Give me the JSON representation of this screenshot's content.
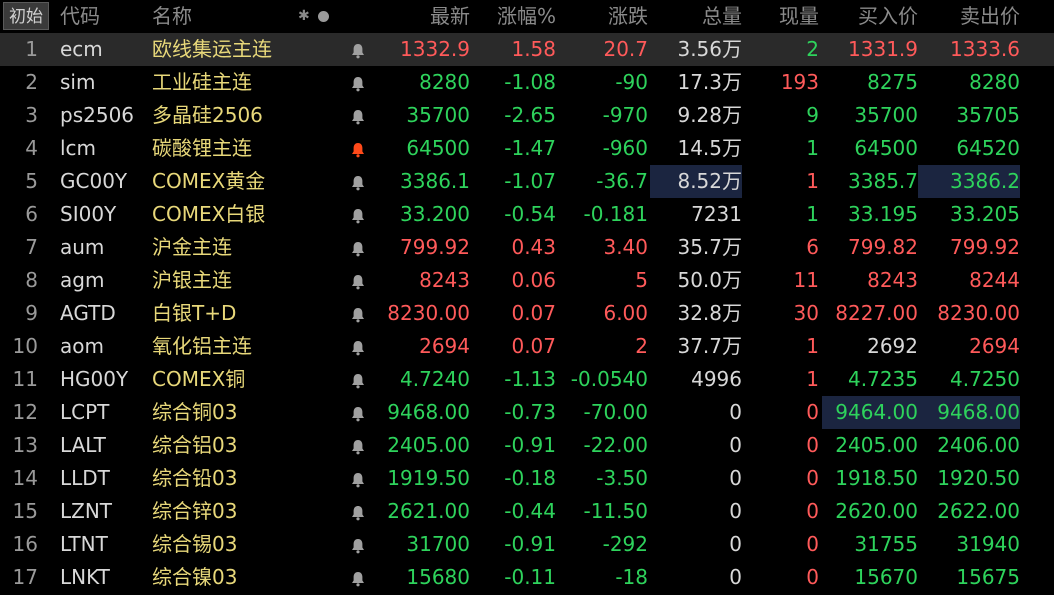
{
  "header": {
    "init_label": "初始",
    "col_code": "代码",
    "col_name": "名称",
    "col_last": "最新",
    "col_pct": "涨幅%",
    "col_chg": "涨跌",
    "col_vol": "总量",
    "col_cur": "现量",
    "col_bid": "买入价",
    "col_ask": "卖出价",
    "icons": [
      "snowflake-icon",
      "dot-icon"
    ]
  },
  "colors": {
    "up": "#ff5a5a",
    "down": "#2ed35c",
    "name": "#e8d87a",
    "bell": "#a0a0a0",
    "bell_active": "#ff4a1a",
    "highlight": "#1b2540",
    "selected_row": "#2a2a2a"
  },
  "rows": [
    {
      "idx": "1",
      "code": "ecm",
      "name": "欧线集运主连",
      "bell": "bell-icon",
      "last": "1332.9",
      "pct": "1.58",
      "chg": "20.7",
      "vol": "3.56万",
      "cur": "2",
      "bid": "1331.9",
      "ask": "1333.6",
      "dir": "up",
      "bid_dir": "up",
      "ask_dir": "up",
      "cur_dir": "down"
    },
    {
      "idx": "2",
      "code": "sim",
      "name": "工业硅主连",
      "bell": "bell-icon",
      "last": "8280",
      "pct": "-1.08",
      "chg": "-90",
      "vol": "17.3万",
      "cur": "193",
      "bid": "8275",
      "ask": "8280",
      "dir": "down",
      "bid_dir": "down",
      "ask_dir": "down",
      "cur_dir": "up"
    },
    {
      "idx": "3",
      "code": "ps2506",
      "name": "多晶硅2506",
      "bell": "bell-icon",
      "last": "35700",
      "pct": "-2.65",
      "chg": "-970",
      "vol": "9.28万",
      "cur": "9",
      "bid": "35700",
      "ask": "35705",
      "dir": "down",
      "bid_dir": "down",
      "ask_dir": "down",
      "cur_dir": "down"
    },
    {
      "idx": "4",
      "code": "lcm",
      "name": "碳酸锂主连",
      "bell": "bell-active-icon",
      "last": "64500",
      "pct": "-1.47",
      "chg": "-960",
      "vol": "14.5万",
      "cur": "1",
      "bid": "64500",
      "ask": "64520",
      "dir": "down",
      "bid_dir": "down",
      "ask_dir": "down",
      "cur_dir": "down"
    },
    {
      "idx": "5",
      "code": "GC00Y",
      "name": "COMEX黄金",
      "bell": "bell-icon",
      "last": "3386.1",
      "pct": "-1.07",
      "chg": "-36.7",
      "vol": "8.52万",
      "cur": "1",
      "bid": "3385.7",
      "ask": "3386.2",
      "dir": "down",
      "bid_dir": "down",
      "ask_dir": "down",
      "cur_dir": "up",
      "vol_hl": true,
      "ask_hl": true
    },
    {
      "idx": "6",
      "code": "SI00Y",
      "name": "COMEX白银",
      "bell": "bell-icon",
      "last": "33.200",
      "pct": "-0.54",
      "chg": "-0.181",
      "vol": "7231",
      "cur": "1",
      "bid": "33.195",
      "ask": "33.205",
      "dir": "down",
      "bid_dir": "down",
      "ask_dir": "down",
      "cur_dir": "down"
    },
    {
      "idx": "7",
      "code": "aum",
      "name": "沪金主连",
      "bell": "bell-icon",
      "last": "799.92",
      "pct": "0.43",
      "chg": "3.40",
      "vol": "35.7万",
      "cur": "6",
      "bid": "799.82",
      "ask": "799.92",
      "dir": "up",
      "bid_dir": "up",
      "ask_dir": "up",
      "cur_dir": "up"
    },
    {
      "idx": "8",
      "code": "agm",
      "name": "沪银主连",
      "bell": "bell-icon",
      "last": "8243",
      "pct": "0.06",
      "chg": "5",
      "vol": "50.0万",
      "cur": "11",
      "bid": "8243",
      "ask": "8244",
      "dir": "up",
      "bid_dir": "up",
      "ask_dir": "up",
      "cur_dir": "up"
    },
    {
      "idx": "9",
      "code": "AGTD",
      "name": "白银T+D",
      "bell": "bell-icon",
      "last": "8230.00",
      "pct": "0.07",
      "chg": "6.00",
      "vol": "32.8万",
      "cur": "30",
      "bid": "8227.00",
      "ask": "8230.00",
      "dir": "up",
      "bid_dir": "up",
      "ask_dir": "up",
      "cur_dir": "up"
    },
    {
      "idx": "10",
      "code": "aom",
      "name": "氧化铝主连",
      "bell": "bell-icon",
      "last": "2694",
      "pct": "0.07",
      "chg": "2",
      "vol": "37.7万",
      "cur": "1",
      "bid": "2692",
      "ask": "2694",
      "dir": "up",
      "bid_dir": "flat",
      "ask_dir": "up",
      "cur_dir": "up"
    },
    {
      "idx": "11",
      "code": "HG00Y",
      "name": "COMEX铜",
      "bell": "bell-icon",
      "last": "4.7240",
      "pct": "-1.13",
      "chg": "-0.0540",
      "vol": "4996",
      "cur": "1",
      "bid": "4.7235",
      "ask": "4.7250",
      "dir": "down",
      "bid_dir": "down",
      "ask_dir": "down",
      "cur_dir": "up"
    },
    {
      "idx": "12",
      "code": "LCPT",
      "name": "综合铜03",
      "bell": "bell-icon",
      "last": "9468.00",
      "pct": "-0.73",
      "chg": "-70.00",
      "vol": "0",
      "cur": "0",
      "bid": "9464.00",
      "ask": "9468.00",
      "dir": "down",
      "bid_dir": "down",
      "ask_dir": "down",
      "cur_dir": "up",
      "bid_hl": true,
      "ask_hl": true
    },
    {
      "idx": "13",
      "code": "LALT",
      "name": "综合铝03",
      "bell": "bell-icon",
      "last": "2405.00",
      "pct": "-0.91",
      "chg": "-22.00",
      "vol": "0",
      "cur": "0",
      "bid": "2405.00",
      "ask": "2406.00",
      "dir": "down",
      "bid_dir": "down",
      "ask_dir": "down",
      "cur_dir": "up"
    },
    {
      "idx": "14",
      "code": "LLDT",
      "name": "综合铅03",
      "bell": "bell-icon",
      "last": "1919.50",
      "pct": "-0.18",
      "chg": "-3.50",
      "vol": "0",
      "cur": "0",
      "bid": "1918.50",
      "ask": "1920.50",
      "dir": "down",
      "bid_dir": "down",
      "ask_dir": "down",
      "cur_dir": "up"
    },
    {
      "idx": "15",
      "code": "LZNT",
      "name": "综合锌03",
      "bell": "bell-icon",
      "last": "2621.00",
      "pct": "-0.44",
      "chg": "-11.50",
      "vol": "0",
      "cur": "0",
      "bid": "2620.00",
      "ask": "2622.00",
      "dir": "down",
      "bid_dir": "down",
      "ask_dir": "down",
      "cur_dir": "up"
    },
    {
      "idx": "16",
      "code": "LTNT",
      "name": "综合锡03",
      "bell": "bell-icon",
      "last": "31700",
      "pct": "-0.91",
      "chg": "-292",
      "vol": "0",
      "cur": "0",
      "bid": "31755",
      "ask": "31940",
      "dir": "down",
      "bid_dir": "down",
      "ask_dir": "down",
      "cur_dir": "up"
    },
    {
      "idx": "17",
      "code": "LNKT",
      "name": "综合镍03",
      "bell": "bell-icon",
      "last": "15680",
      "pct": "-0.11",
      "chg": "-18",
      "vol": "0",
      "cur": "0",
      "bid": "15670",
      "ask": "15675",
      "dir": "down",
      "bid_dir": "down",
      "ask_dir": "down",
      "cur_dir": "up"
    }
  ]
}
